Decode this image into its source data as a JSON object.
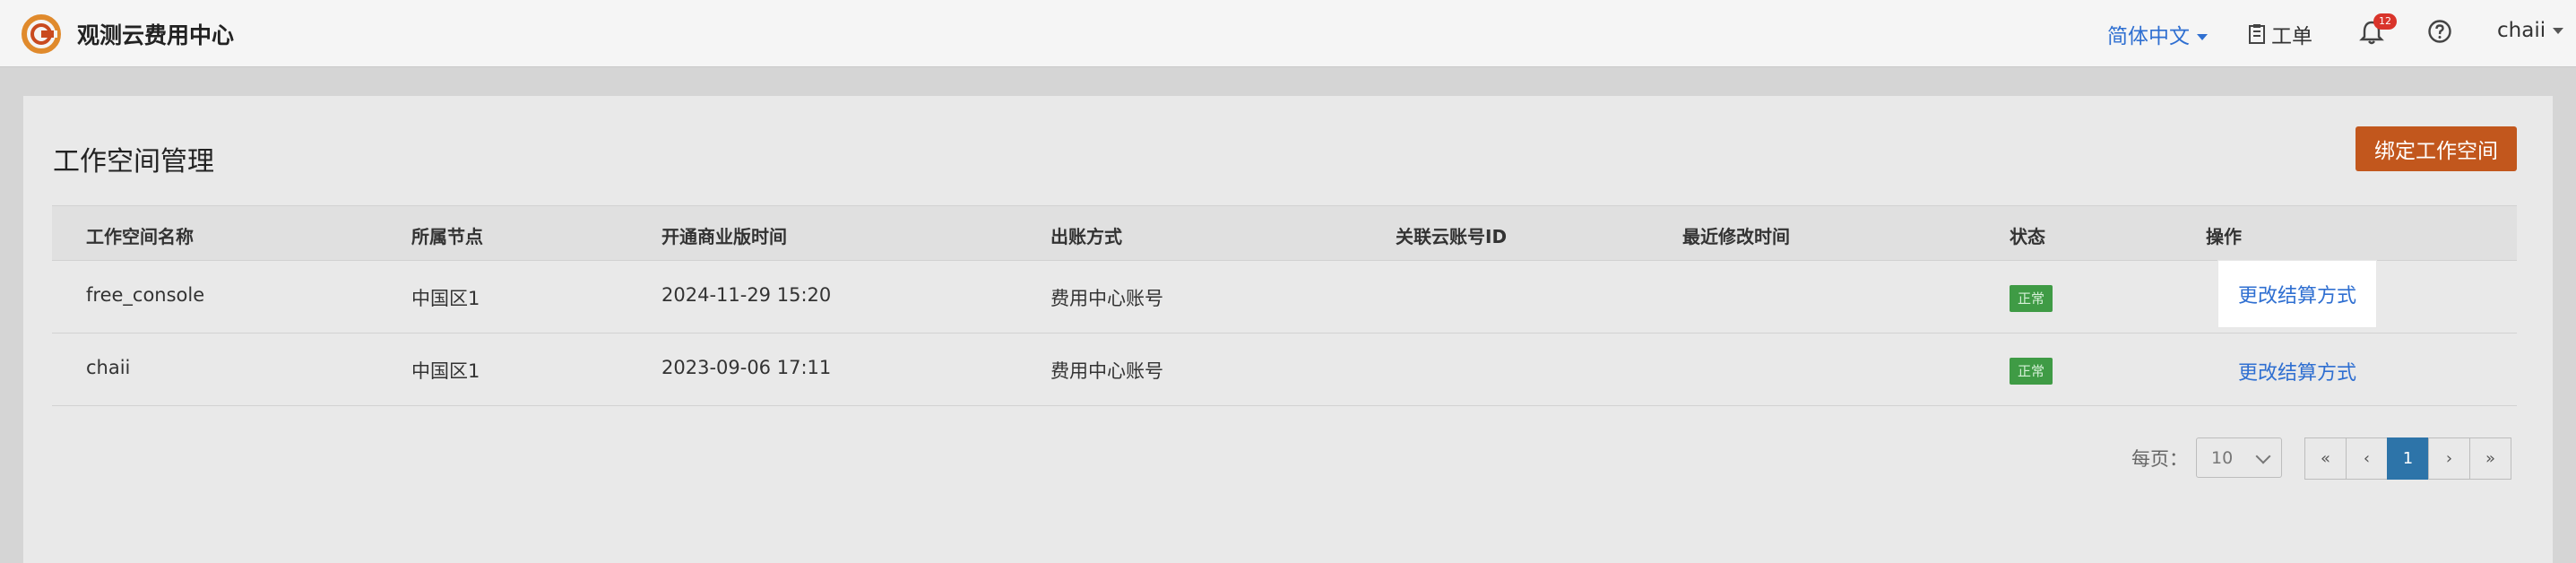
{
  "header": {
    "app_title": "观测云费用中心",
    "language": "简体中文",
    "ticket_label": "工单",
    "notification_count": "12",
    "username": "chaii"
  },
  "page": {
    "title": "工作空间管理",
    "bind_button": "绑定工作空间"
  },
  "table": {
    "columns": [
      "工作空间名称",
      "所属节点",
      "开通商业版时间",
      "出账方式",
      "关联云账号ID",
      "最近修改时间",
      "状态",
      "操作"
    ],
    "rows": [
      {
        "name": "free_console",
        "node": "中国区1",
        "open_time": "2024-11-29 15:20",
        "billing": "费用中心账号",
        "cloud_id": "",
        "modified": "",
        "status": "正常",
        "action": "更改结算方式"
      },
      {
        "name": "chaii",
        "node": "中国区1",
        "open_time": "2023-09-06 17:11",
        "billing": "费用中心账号",
        "cloud_id": "",
        "modified": "",
        "status": "正常",
        "action": "更改结算方式"
      }
    ]
  },
  "pagination": {
    "per_page_label": "每页：",
    "page_size": "10",
    "first": "«",
    "prev": "‹",
    "current": "1",
    "next": "›",
    "last": "»"
  },
  "colors": {
    "accent_button": "#c2571d",
    "link": "#2f6fd1",
    "status_ok": "#3f9b45",
    "active_page": "#2d74a9"
  }
}
